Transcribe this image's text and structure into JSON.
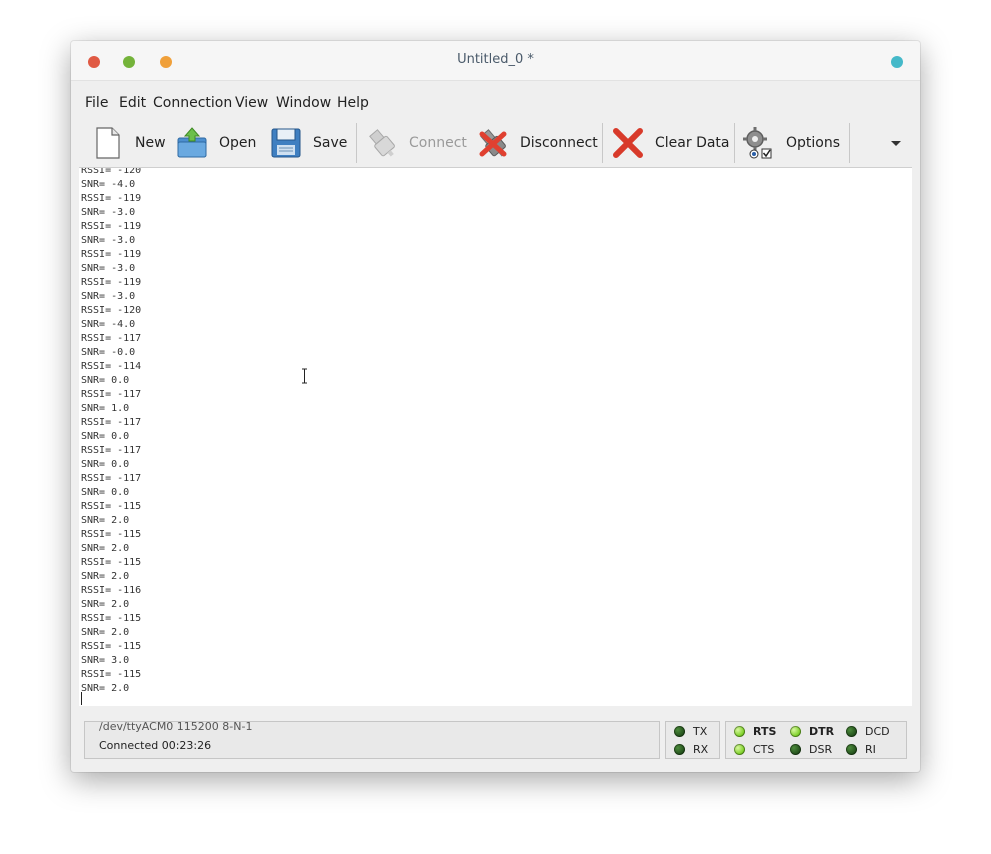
{
  "window": {
    "title": "Untitled_0 *"
  },
  "menu": [
    "File",
    "Edit",
    "Connection",
    "View",
    "Window",
    "Help"
  ],
  "toolbar": {
    "new": "New",
    "open": "Open",
    "save": "Save",
    "connect": "Connect",
    "disconnect": "Disconnect",
    "clear": "Clear Data",
    "options": "Options"
  },
  "terminal": {
    "lines": [
      "RSSI= -120",
      "SNR= -4.0",
      "RSSI= -119",
      "SNR= -3.0",
      "RSSI= -119",
      "SNR= -3.0",
      "RSSI= -119",
      "SNR= -3.0",
      "RSSI= -119",
      "SNR= -3.0",
      "RSSI= -120",
      "SNR= -4.0",
      "RSSI= -117",
      "SNR= -0.0",
      "RSSI= -114",
      "SNR= 0.0",
      "RSSI= -117",
      "SNR= 1.0",
      "RSSI= -117",
      "SNR= 0.0",
      "RSSI= -117",
      "SNR= 0.0",
      "RSSI= -117",
      "SNR= 0.0",
      "RSSI= -115",
      "SNR= 2.0",
      "RSSI= -115",
      "SNR= 2.0",
      "RSSI= -115",
      "SNR= 2.0",
      "RSSI= -116",
      "SNR= 2.0",
      "RSSI= -115",
      "SNR= 2.0",
      "RSSI= -115",
      "SNR= 3.0",
      "RSSI= -115",
      "SNR= 2.0"
    ]
  },
  "status": {
    "port": "/dev/ttyACM0  115200 8-N-1",
    "connected": "Connected 00:23:26"
  },
  "leds": {
    "tx": {
      "label": "TX",
      "on": false
    },
    "rx": {
      "label": "RX",
      "on": false
    },
    "rts": {
      "label": "RTS",
      "on": true
    },
    "cts": {
      "label": "CTS",
      "on": true
    },
    "dtr": {
      "label": "DTR",
      "on": true
    },
    "dsr": {
      "label": "DSR",
      "on": false
    },
    "dcd": {
      "label": "DCD",
      "on": false
    },
    "ri": {
      "label": "RI",
      "on": false
    }
  }
}
